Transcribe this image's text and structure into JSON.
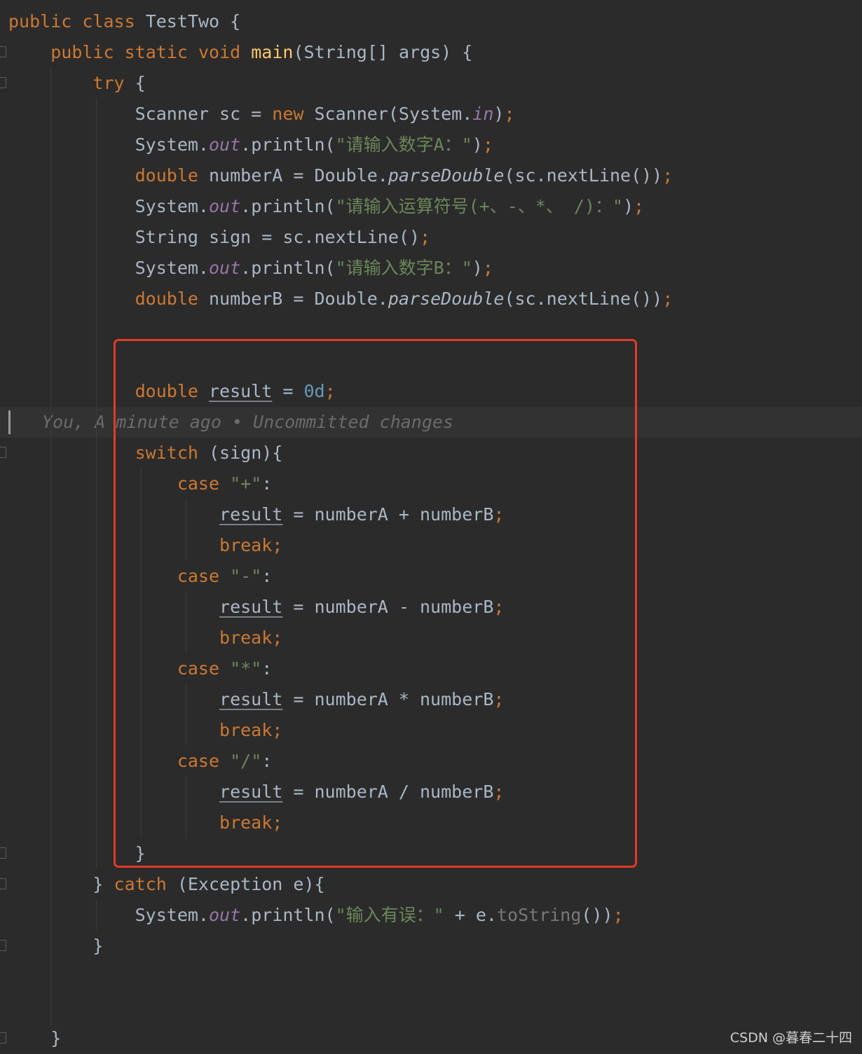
{
  "editor": {
    "lines": [
      "public class TestTwo {",
      "    public static void main(String[] args) {",
      "        try {",
      "            Scanner sc = new Scanner(System.in);",
      "            System.out.println(\"请输入数字A：\");",
      "            double numberA = Double.parseDouble(sc.nextLine());",
      "            System.out.println(\"请输入运算符号(+、-、*、 /)：\");",
      "            String sign = sc.nextLine();",
      "            System.out.println(\"请输入数字B：\");",
      "            double numberB = Double.parseDouble(sc.nextLine());",
      "",
      "",
      "            double result = 0d;",
      "            switch (sign){",
      "                case \"+\":",
      "                    result = numberA + numberB;",
      "                    break;",
      "                case \"-\":",
      "                    result = numberA - numberB;",
      "                    break;",
      "                case \"*\":",
      "                    result = numberA * numberB;",
      "                    break;",
      "                case \"/\":",
      "                    result = numberA / numberB;",
      "                    break;",
      "            }",
      "        } catch (Exception e){",
      "            System.out.println(\"输入有误：\" + e.toString());",
      "        }",
      "",
      "",
      "    }"
    ],
    "blame": "You, A minute ago • Uncommitted changes"
  },
  "watermark": "CSDN @暮春二十四",
  "colors": {
    "background": "#2b2b2b",
    "keyword": "#cc7832",
    "method": "#ffc66d",
    "string": "#6a8759",
    "number": "#6897bb",
    "field": "#9876aa",
    "text": "#a9b7c6",
    "highlight_box": "#e03c27"
  }
}
